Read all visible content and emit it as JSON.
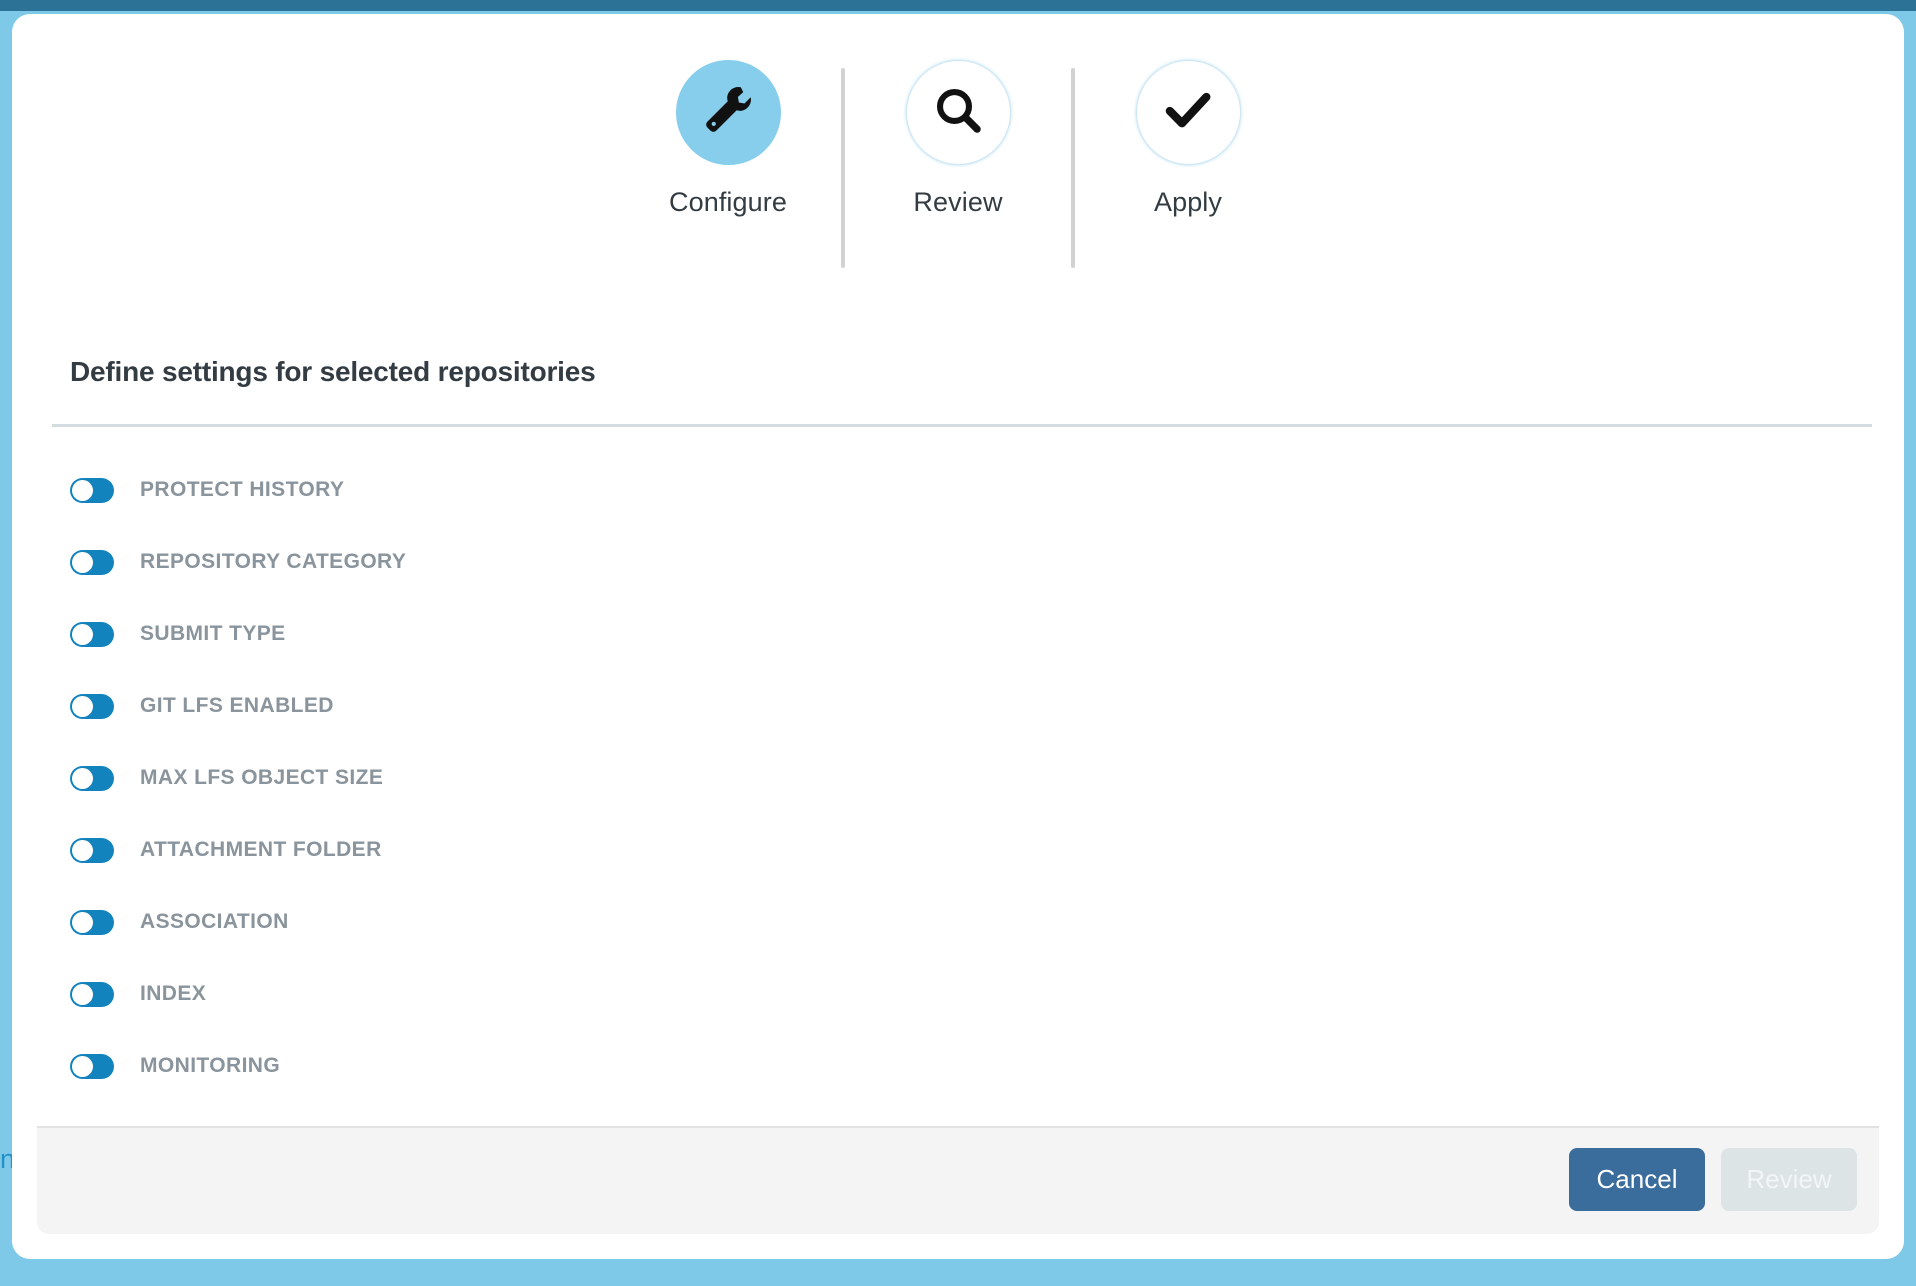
{
  "window": {
    "top_bar_color": "#2c7296",
    "backdrop_color": "#7fc9e8",
    "background_page_fragment": "n"
  },
  "stepper": {
    "steps": [
      {
        "label": "Configure",
        "icon": "wrench-icon",
        "state": "active"
      },
      {
        "label": "Review",
        "icon": "search-icon",
        "state": "inactive"
      },
      {
        "label": "Apply",
        "icon": "check-icon",
        "state": "inactive"
      }
    ]
  },
  "main": {
    "section_title": "Define settings for selected repositories",
    "settings": [
      {
        "label": "PROTECT HISTORY",
        "enabled": true
      },
      {
        "label": "REPOSITORY CATEGORY",
        "enabled": true
      },
      {
        "label": "SUBMIT TYPE",
        "enabled": true
      },
      {
        "label": "GIT LFS ENABLED",
        "enabled": true
      },
      {
        "label": "MAX LFS OBJECT SIZE",
        "enabled": true
      },
      {
        "label": "ATTACHMENT FOLDER",
        "enabled": true
      },
      {
        "label": "ASSOCIATION",
        "enabled": true
      },
      {
        "label": "INDEX",
        "enabled": true
      },
      {
        "label": "MONITORING",
        "enabled": true
      }
    ]
  },
  "footer": {
    "cancel_label": "Cancel",
    "review_label": "Review",
    "cancel_color": "#3a6c9c",
    "review_color": "#dce4e5"
  },
  "colors": {
    "accent_blue": "#1283bd",
    "step_active": "#87cdec",
    "label_gray": "#8a949c",
    "title_dark": "#343c43"
  }
}
